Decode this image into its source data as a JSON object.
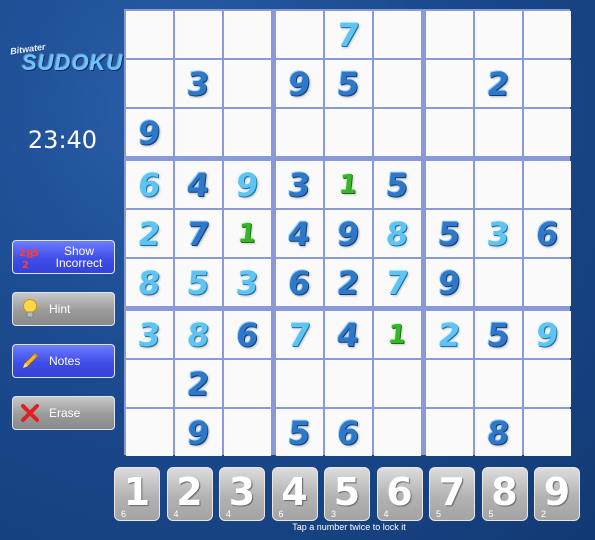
{
  "logo": {
    "small": "Bitwater",
    "big": "SUDOKU"
  },
  "timer": "23:40",
  "buttons": {
    "show_incorrect": "Show Incorrect",
    "hint": "Hint",
    "notes": "Notes",
    "erase": "Erase"
  },
  "colors": {
    "accent": "#3f4ee8",
    "board_line": "#8a9ad8",
    "given": "#2f78c7",
    "user": "#5fc4f2",
    "hint": "#39b52c"
  },
  "board": [
    [
      {
        "v": ""
      },
      {
        "v": ""
      },
      {
        "v": ""
      },
      {
        "v": ""
      },
      {
        "v": "7",
        "k": "user"
      },
      {
        "v": ""
      },
      {
        "v": ""
      },
      {
        "v": ""
      },
      {
        "v": ""
      }
    ],
    [
      {
        "v": ""
      },
      {
        "v": "3",
        "k": "given"
      },
      {
        "v": ""
      },
      {
        "v": "9",
        "k": "given"
      },
      {
        "v": "5",
        "k": "given"
      },
      {
        "v": ""
      },
      {
        "v": ""
      },
      {
        "v": "2",
        "k": "given"
      },
      {
        "v": ""
      }
    ],
    [
      {
        "v": "9",
        "k": "given"
      },
      {
        "v": ""
      },
      {
        "v": ""
      },
      {
        "v": ""
      },
      {
        "v": ""
      },
      {
        "v": ""
      },
      {
        "v": ""
      },
      {
        "v": ""
      },
      {
        "v": ""
      }
    ],
    [
      {
        "v": "6",
        "k": "user"
      },
      {
        "v": "4",
        "k": "given"
      },
      {
        "v": "9",
        "k": "user"
      },
      {
        "v": "3",
        "k": "given"
      },
      {
        "v": "1",
        "k": "hint"
      },
      {
        "v": "5",
        "k": "given"
      },
      {
        "v": ""
      },
      {
        "v": ""
      },
      {
        "v": ""
      }
    ],
    [
      {
        "v": "2",
        "k": "user"
      },
      {
        "v": "7",
        "k": "given"
      },
      {
        "v": "1",
        "k": "hint"
      },
      {
        "v": "4",
        "k": "given"
      },
      {
        "v": "9",
        "k": "given"
      },
      {
        "v": "8",
        "k": "user"
      },
      {
        "v": "5",
        "k": "given"
      },
      {
        "v": "3",
        "k": "user"
      },
      {
        "v": "6",
        "k": "given"
      }
    ],
    [
      {
        "v": "8",
        "k": "user"
      },
      {
        "v": "5",
        "k": "user"
      },
      {
        "v": "3",
        "k": "user"
      },
      {
        "v": "6",
        "k": "given"
      },
      {
        "v": "2",
        "k": "given"
      },
      {
        "v": "7",
        "k": "user"
      },
      {
        "v": "9",
        "k": "given"
      },
      {
        "v": ""
      },
      {
        "v": ""
      }
    ],
    [
      {
        "v": "3",
        "k": "user"
      },
      {
        "v": "8",
        "k": "user"
      },
      {
        "v": "6",
        "k": "given"
      },
      {
        "v": "7",
        "k": "user"
      },
      {
        "v": "4",
        "k": "given"
      },
      {
        "v": "1",
        "k": "hint"
      },
      {
        "v": "2",
        "k": "user"
      },
      {
        "v": "5",
        "k": "given"
      },
      {
        "v": "9",
        "k": "user"
      }
    ],
    [
      {
        "v": ""
      },
      {
        "v": "2",
        "k": "given"
      },
      {
        "v": ""
      },
      {
        "v": ""
      },
      {
        "v": ""
      },
      {
        "v": ""
      },
      {
        "v": ""
      },
      {
        "v": ""
      },
      {
        "v": ""
      }
    ],
    [
      {
        "v": ""
      },
      {
        "v": "9",
        "k": "given"
      },
      {
        "v": ""
      },
      {
        "v": "5",
        "k": "given"
      },
      {
        "v": "6",
        "k": "given"
      },
      {
        "v": ""
      },
      {
        "v": ""
      },
      {
        "v": "8",
        "k": "given"
      },
      {
        "v": ""
      }
    ]
  ],
  "numpad": [
    {
      "n": "1",
      "c": "6"
    },
    {
      "n": "2",
      "c": "4"
    },
    {
      "n": "3",
      "c": "4"
    },
    {
      "n": "4",
      "c": "6"
    },
    {
      "n": "5",
      "c": "3"
    },
    {
      "n": "6",
      "c": "4"
    },
    {
      "n": "7",
      "c": "5"
    },
    {
      "n": "8",
      "c": "5"
    },
    {
      "n": "9",
      "c": "2"
    }
  ],
  "tip": "Tap a number twice to lock it"
}
